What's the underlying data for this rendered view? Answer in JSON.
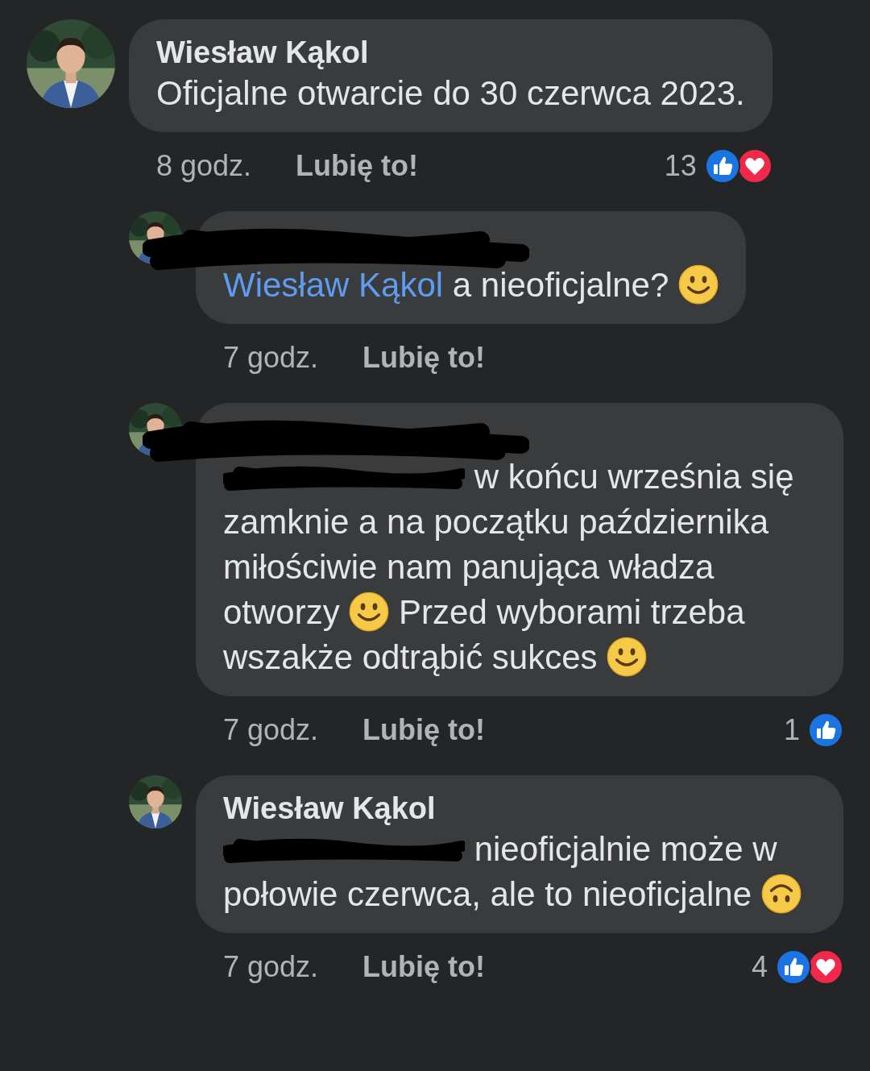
{
  "comments": [
    {
      "reply": false,
      "author": "Wiesław Kąkol",
      "author_redacted": false,
      "body": [
        {
          "kind": "text",
          "text": "Oficjalne otwarcie do 30 czerwca 2023."
        }
      ],
      "time": "8 godz.",
      "like_label": "Lubię to!",
      "reaction_count": "13",
      "reactions": [
        {
          "kind": "like"
        },
        {
          "kind": "love"
        }
      ]
    },
    {
      "reply": true,
      "author_redacted": true,
      "body": [
        {
          "kind": "mention",
          "text": "Wiesław Kąkol"
        },
        {
          "kind": "text",
          "text": " a nieoficjalne? "
        },
        {
          "kind": "smile"
        }
      ],
      "time": "7 godz.",
      "like_label": "Lubię to!"
    },
    {
      "reply": true,
      "author_redacted": true,
      "body": [
        {
          "kind": "redacted"
        },
        {
          "kind": "text",
          "text": " w końcu września się zamknie a na początku października miłościwie nam panująca władza otworzy "
        },
        {
          "kind": "smile"
        },
        {
          "kind": "text",
          "text": " Przed wyborami trzeba wszakże odtrąbić sukces "
        },
        {
          "kind": "smile"
        }
      ],
      "time": "7 godz.",
      "like_label": "Lubię to!",
      "reaction_count": "1",
      "reactions": [
        {
          "kind": "like"
        }
      ]
    },
    {
      "reply": true,
      "author": "Wiesław Kąkol",
      "author_redacted": false,
      "body": [
        {
          "kind": "redacted"
        },
        {
          "kind": "text",
          "text": " nieoficjalnie może w połowie czerwca, ale to nieoficjalne "
        },
        {
          "kind": "upside_down"
        }
      ],
      "time": "7 godz.",
      "like_label": "Lubię to!",
      "reaction_count": "4",
      "reactions": [
        {
          "kind": "like"
        },
        {
          "kind": "love"
        }
      ]
    }
  ]
}
